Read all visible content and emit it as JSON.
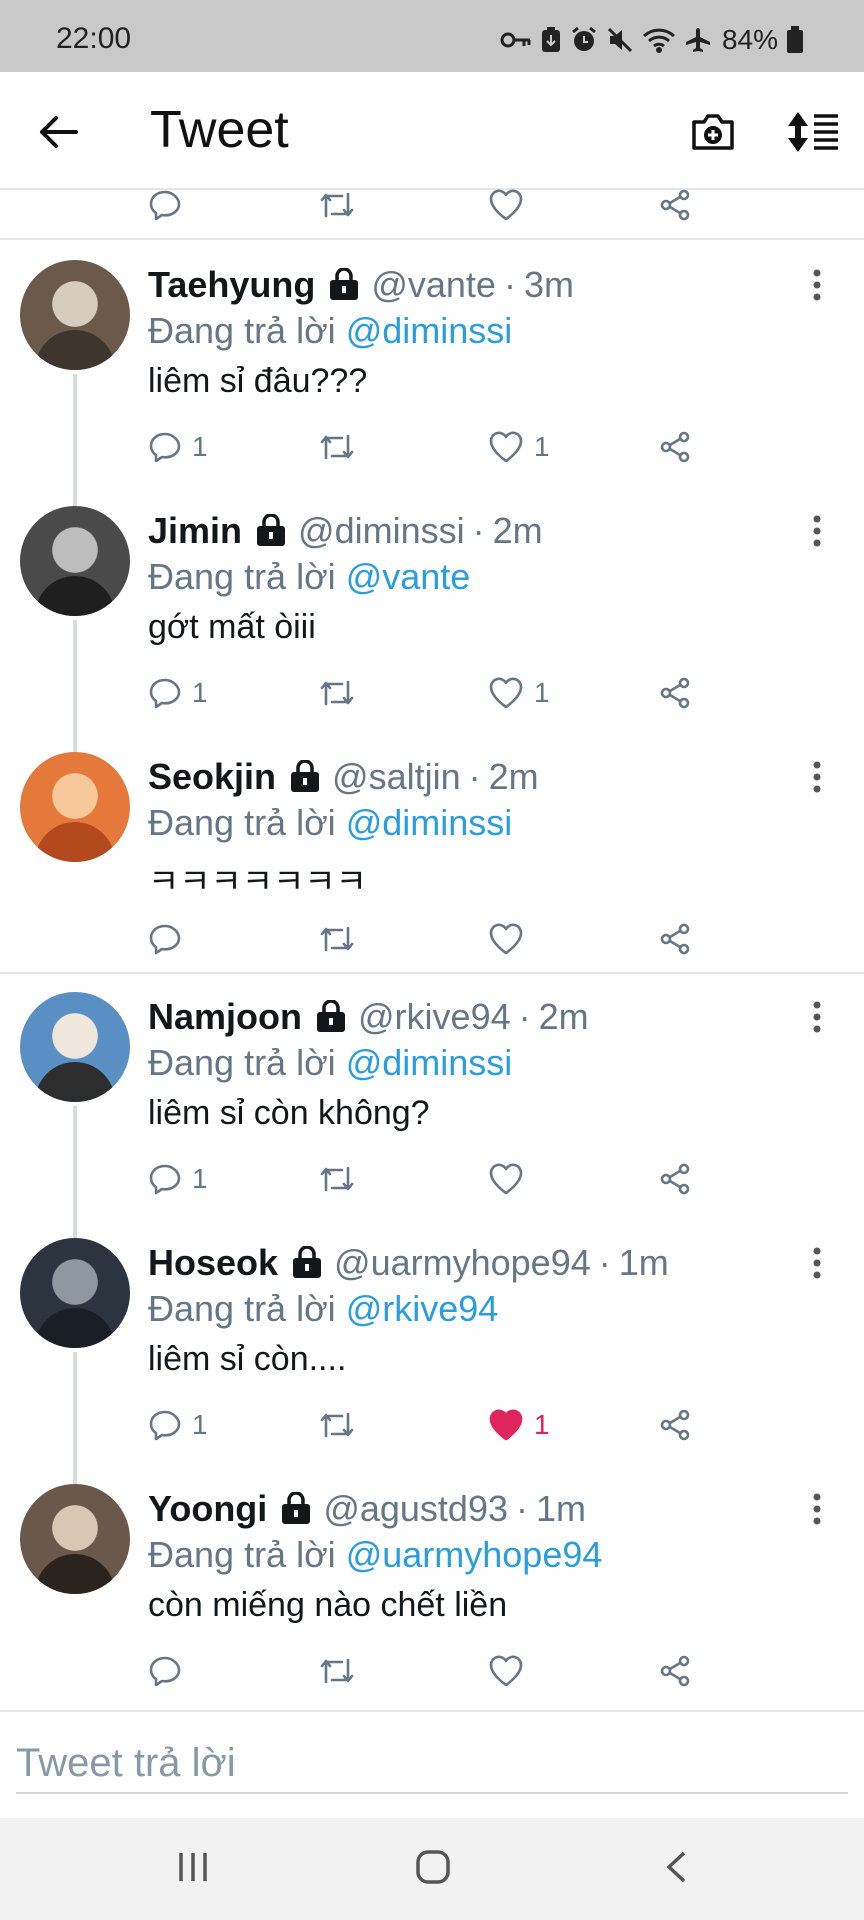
{
  "status_bar": {
    "time": "22:00",
    "battery_percent": "84%",
    "icons": [
      "key-icon",
      "battery-saver-icon",
      "alarm-icon",
      "mute-icon",
      "wifi-icon",
      "airplane-icon",
      "battery-icon"
    ]
  },
  "app_bar": {
    "title": "Tweet",
    "icons": [
      "back-arrow-icon",
      "camera-plus-icon",
      "sort-icon"
    ]
  },
  "reply_prefix": "Đang trả lời",
  "tweets": [
    {
      "name": "Taehyung",
      "handle": "@vante",
      "sep": "·",
      "time": "3m",
      "reply_to": "@diminssi",
      "text": "liêm sỉ đâu???",
      "replies": "1",
      "likes": "1",
      "liked": false
    },
    {
      "name": "Jimin",
      "handle": "@diminssi",
      "sep": "·",
      "time": "2m",
      "reply_to": "@vante",
      "text": "gớt mất òiii",
      "replies": "1",
      "likes": "1",
      "liked": false
    },
    {
      "name": "Seokjin",
      "handle": "@saltjin",
      "sep": "·",
      "time": "2m",
      "reply_to": "@diminssi",
      "text": "ㅋㅋㅋㅋㅋㅋㅋ",
      "replies": "",
      "likes": "",
      "liked": false
    },
    {
      "name": "Namjoon",
      "handle": "@rkive94",
      "sep": "·",
      "time": "2m",
      "reply_to": "@diminssi",
      "text": "liêm sỉ còn không?",
      "replies": "1",
      "likes": "",
      "liked": false
    },
    {
      "name": "Hoseok",
      "handle": "@uarmyhope94",
      "sep": "·",
      "time": "1m",
      "reply_to": "@rkive94",
      "text": "liêm sỉ còn....",
      "replies": "1",
      "likes": "1",
      "liked": true
    },
    {
      "name": "Yoongi",
      "handle": "@agustd93",
      "sep": "·",
      "time": "1m",
      "reply_to": "@uarmyhope94",
      "text": "còn miếng nào chết liền",
      "replies": "",
      "likes": "",
      "liked": false
    }
  ],
  "reply_bar": {
    "placeholder": "Tweet trả lời"
  },
  "colors": {
    "link": "#2a9ddc",
    "muted": "#657786",
    "like_active": "#e0245e",
    "status_bar_bg": "#c9c9c9"
  }
}
